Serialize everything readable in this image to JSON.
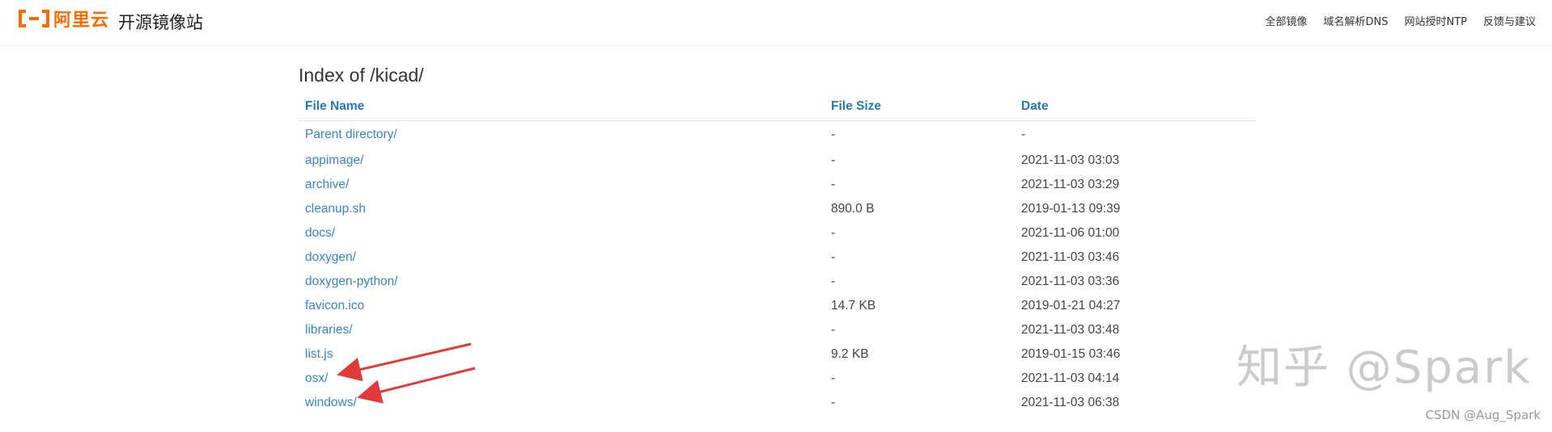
{
  "header": {
    "logo_text": "阿里云",
    "site_title": "开源镜像站",
    "nav": [
      "全部镜像",
      "域名解析DNS",
      "网站授时NTP",
      "反馈与建议"
    ]
  },
  "listing": {
    "title": "Index of /kicad/",
    "columns": [
      "File Name",
      "File Size",
      "Date"
    ],
    "rows": [
      {
        "name": "Parent directory/",
        "size": "-",
        "date": "-"
      },
      {
        "name": "appimage/",
        "size": "-",
        "date": "2021-11-03 03:03"
      },
      {
        "name": "archive/",
        "size": "-",
        "date": "2021-11-03 03:29"
      },
      {
        "name": "cleanup.sh",
        "size": "890.0 B",
        "date": "2019-01-13 09:39"
      },
      {
        "name": "docs/",
        "size": "-",
        "date": "2021-11-06 01:00"
      },
      {
        "name": "doxygen/",
        "size": "-",
        "date": "2021-11-03 03:46"
      },
      {
        "name": "doxygen-python/",
        "size": "-",
        "date": "2021-11-03 03:36"
      },
      {
        "name": "favicon.ico",
        "size": "14.7 KB",
        "date": "2019-01-21 04:27"
      },
      {
        "name": "libraries/",
        "size": "-",
        "date": "2021-11-03 03:48"
      },
      {
        "name": "list.js",
        "size": "9.2 KB",
        "date": "2019-01-15 03:46"
      },
      {
        "name": "osx/",
        "size": "-",
        "date": "2021-11-03 04:14"
      },
      {
        "name": "windows/",
        "size": "-",
        "date": "2021-11-03 06:38"
      }
    ]
  },
  "overlay": {
    "watermark": "知乎 @Spark",
    "credit": "CSDN @Aug_Spark",
    "arrow_color": "#e03a3a"
  },
  "colors": {
    "brand": "#ff6a00",
    "link": "#3a85c4",
    "header_link": "#2a7ab0"
  }
}
